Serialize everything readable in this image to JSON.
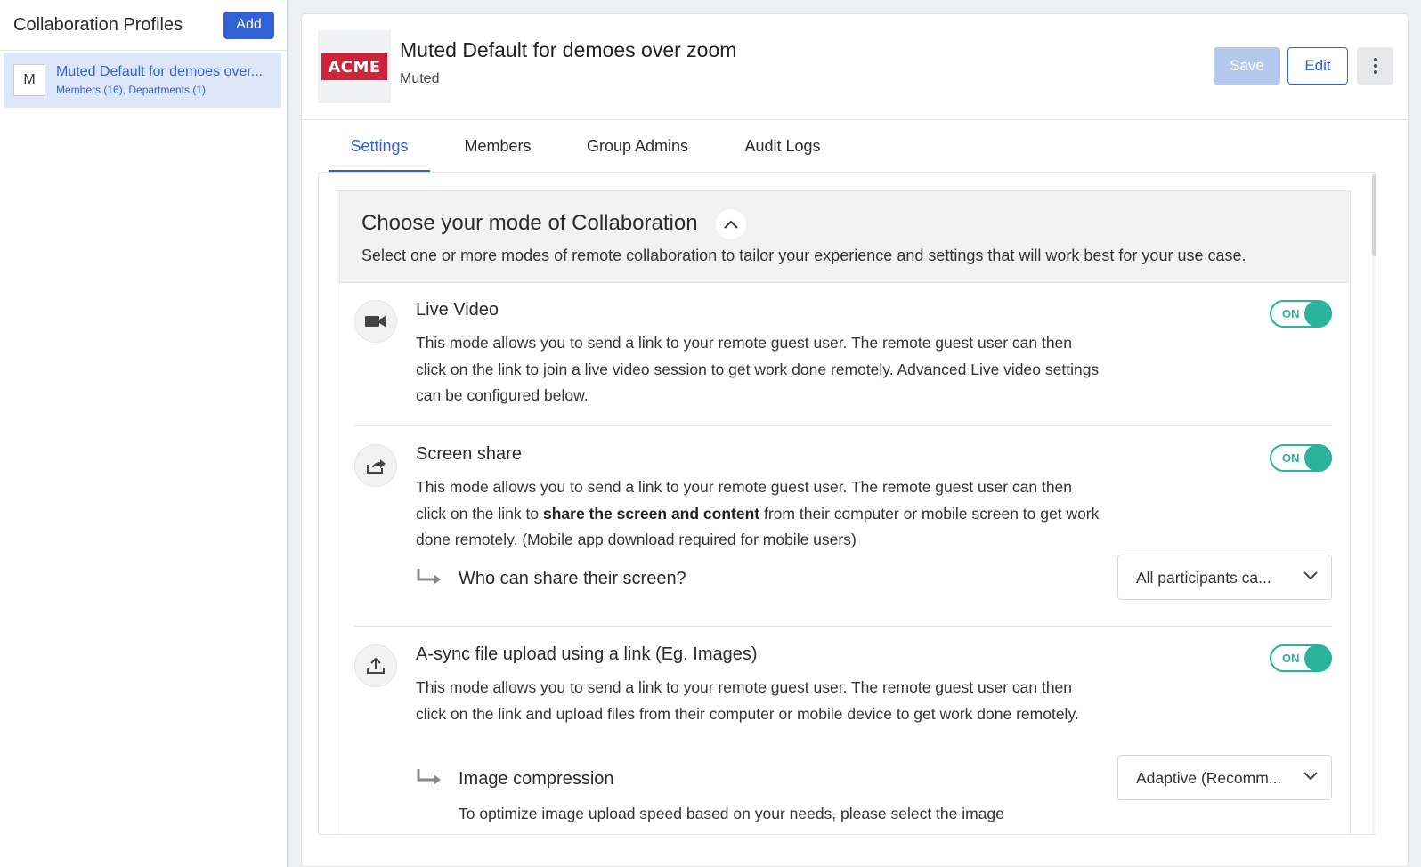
{
  "sidebar": {
    "title": "Collaboration Profiles",
    "add_label": "Add",
    "items": [
      {
        "avatar": "M",
        "name": "Muted Default for demoes over...",
        "meta": "Members (16), Departments (1)"
      }
    ]
  },
  "header": {
    "logo_text": "ACME",
    "title": "Muted Default for demoes over zoom",
    "subtitle": "Muted",
    "save_label": "Save",
    "edit_label": "Edit",
    "more_icon": "kebab-menu-icon"
  },
  "tabs": [
    {
      "label": "Settings",
      "active": true
    },
    {
      "label": "Members",
      "active": false
    },
    {
      "label": "Group Admins",
      "active": false
    },
    {
      "label": "Audit Logs",
      "active": false
    }
  ],
  "section": {
    "title": "Choose your mode of Collaboration",
    "description": "Select one or more modes of remote collaboration to tailor your experience and settings that will work best for your use case.",
    "collapse_icon": "chevron-up-icon"
  },
  "modes": [
    {
      "icon": "video-camera-icon",
      "title": "Live Video",
      "description": "This mode allows you to send a link to your remote guest user. The remote guest user can then click on the link to join a live video session to get work done remotely. Advanced Live video settings can be configured below.",
      "toggle": "ON"
    },
    {
      "icon": "share-icon",
      "title": "Screen share",
      "description_pre": "This mode allows you to send a link to your remote guest user. The remote guest user can then click on the link to ",
      "description_bold": "share the screen and content",
      "description_post": " from their computer or mobile screen to get work done remotely. (Mobile app download required for mobile users)",
      "toggle": "ON",
      "sub_setting": {
        "label": "Who can share their screen?",
        "value": "All participants ca..."
      }
    },
    {
      "icon": "upload-icon",
      "title": "A-sync file upload using a link (Eg. Images)",
      "description": "This mode allows you to send a link to your remote guest user. The remote guest user can then click on the link and upload files from their computer or mobile device to get work done remotely.",
      "toggle": "ON",
      "sub_setting": {
        "label": "Image compression",
        "description": "To optimize image upload speed based on your needs, please select the image",
        "value": "Adaptive (Recomm..."
      }
    }
  ],
  "colors": {
    "accent": "#2f62d6",
    "toggle_on": "#28b39a",
    "logo_red": "#d0223a",
    "selected_bg": "#dde7f9"
  }
}
